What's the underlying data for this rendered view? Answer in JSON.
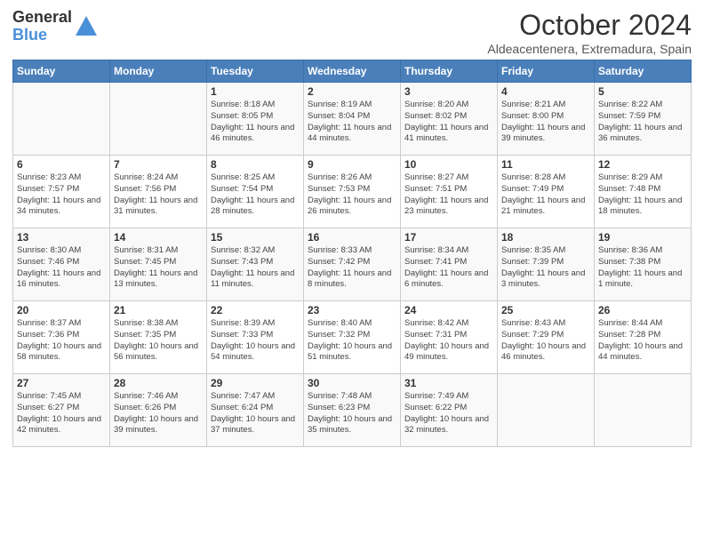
{
  "logo": {
    "general": "General",
    "blue": "Blue"
  },
  "header": {
    "month": "October 2024",
    "subtitle": "Aldeacentenera, Extremadura, Spain"
  },
  "weekdays": [
    "Sunday",
    "Monday",
    "Tuesday",
    "Wednesday",
    "Thursday",
    "Friday",
    "Saturday"
  ],
  "weeks": [
    [
      {
        "day": "",
        "content": ""
      },
      {
        "day": "",
        "content": ""
      },
      {
        "day": "1",
        "content": "Sunrise: 8:18 AM\nSunset: 8:05 PM\nDaylight: 11 hours and 46 minutes."
      },
      {
        "day": "2",
        "content": "Sunrise: 8:19 AM\nSunset: 8:04 PM\nDaylight: 11 hours and 44 minutes."
      },
      {
        "day": "3",
        "content": "Sunrise: 8:20 AM\nSunset: 8:02 PM\nDaylight: 11 hours and 41 minutes."
      },
      {
        "day": "4",
        "content": "Sunrise: 8:21 AM\nSunset: 8:00 PM\nDaylight: 11 hours and 39 minutes."
      },
      {
        "day": "5",
        "content": "Sunrise: 8:22 AM\nSunset: 7:59 PM\nDaylight: 11 hours and 36 minutes."
      }
    ],
    [
      {
        "day": "6",
        "content": "Sunrise: 8:23 AM\nSunset: 7:57 PM\nDaylight: 11 hours and 34 minutes."
      },
      {
        "day": "7",
        "content": "Sunrise: 8:24 AM\nSunset: 7:56 PM\nDaylight: 11 hours and 31 minutes."
      },
      {
        "day": "8",
        "content": "Sunrise: 8:25 AM\nSunset: 7:54 PM\nDaylight: 11 hours and 28 minutes."
      },
      {
        "day": "9",
        "content": "Sunrise: 8:26 AM\nSunset: 7:53 PM\nDaylight: 11 hours and 26 minutes."
      },
      {
        "day": "10",
        "content": "Sunrise: 8:27 AM\nSunset: 7:51 PM\nDaylight: 11 hours and 23 minutes."
      },
      {
        "day": "11",
        "content": "Sunrise: 8:28 AM\nSunset: 7:49 PM\nDaylight: 11 hours and 21 minutes."
      },
      {
        "day": "12",
        "content": "Sunrise: 8:29 AM\nSunset: 7:48 PM\nDaylight: 11 hours and 18 minutes."
      }
    ],
    [
      {
        "day": "13",
        "content": "Sunrise: 8:30 AM\nSunset: 7:46 PM\nDaylight: 11 hours and 16 minutes."
      },
      {
        "day": "14",
        "content": "Sunrise: 8:31 AM\nSunset: 7:45 PM\nDaylight: 11 hours and 13 minutes."
      },
      {
        "day": "15",
        "content": "Sunrise: 8:32 AM\nSunset: 7:43 PM\nDaylight: 11 hours and 11 minutes."
      },
      {
        "day": "16",
        "content": "Sunrise: 8:33 AM\nSunset: 7:42 PM\nDaylight: 11 hours and 8 minutes."
      },
      {
        "day": "17",
        "content": "Sunrise: 8:34 AM\nSunset: 7:41 PM\nDaylight: 11 hours and 6 minutes."
      },
      {
        "day": "18",
        "content": "Sunrise: 8:35 AM\nSunset: 7:39 PM\nDaylight: 11 hours and 3 minutes."
      },
      {
        "day": "19",
        "content": "Sunrise: 8:36 AM\nSunset: 7:38 PM\nDaylight: 11 hours and 1 minute."
      }
    ],
    [
      {
        "day": "20",
        "content": "Sunrise: 8:37 AM\nSunset: 7:36 PM\nDaylight: 10 hours and 58 minutes."
      },
      {
        "day": "21",
        "content": "Sunrise: 8:38 AM\nSunset: 7:35 PM\nDaylight: 10 hours and 56 minutes."
      },
      {
        "day": "22",
        "content": "Sunrise: 8:39 AM\nSunset: 7:33 PM\nDaylight: 10 hours and 54 minutes."
      },
      {
        "day": "23",
        "content": "Sunrise: 8:40 AM\nSunset: 7:32 PM\nDaylight: 10 hours and 51 minutes."
      },
      {
        "day": "24",
        "content": "Sunrise: 8:42 AM\nSunset: 7:31 PM\nDaylight: 10 hours and 49 minutes."
      },
      {
        "day": "25",
        "content": "Sunrise: 8:43 AM\nSunset: 7:29 PM\nDaylight: 10 hours and 46 minutes."
      },
      {
        "day": "26",
        "content": "Sunrise: 8:44 AM\nSunset: 7:28 PM\nDaylight: 10 hours and 44 minutes."
      }
    ],
    [
      {
        "day": "27",
        "content": "Sunrise: 7:45 AM\nSunset: 6:27 PM\nDaylight: 10 hours and 42 minutes."
      },
      {
        "day": "28",
        "content": "Sunrise: 7:46 AM\nSunset: 6:26 PM\nDaylight: 10 hours and 39 minutes."
      },
      {
        "day": "29",
        "content": "Sunrise: 7:47 AM\nSunset: 6:24 PM\nDaylight: 10 hours and 37 minutes."
      },
      {
        "day": "30",
        "content": "Sunrise: 7:48 AM\nSunset: 6:23 PM\nDaylight: 10 hours and 35 minutes."
      },
      {
        "day": "31",
        "content": "Sunrise: 7:49 AM\nSunset: 6:22 PM\nDaylight: 10 hours and 32 minutes."
      },
      {
        "day": "",
        "content": ""
      },
      {
        "day": "",
        "content": ""
      }
    ]
  ]
}
